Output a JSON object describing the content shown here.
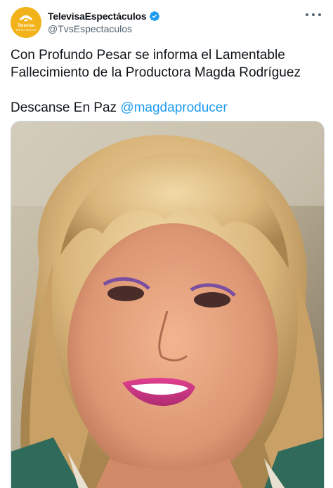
{
  "account": {
    "display_name": "TelevisaEspectáculos",
    "handle": "@TvsEspectaculos",
    "avatar_brand": "Televisa",
    "avatar_sub": "ESPECTÁCULOS",
    "verified": true
  },
  "tweet": {
    "line1": "Con Profundo Pesar se informa el Lamentable",
    "line2": "Fallecimiento de la Productora Magda Rodríguez",
    "line3_prefix": "Descanse En Paz ",
    "mention": "@magdaproducer"
  },
  "media": {
    "description_icon": "photo"
  },
  "colors": {
    "accent": "#1d9bf0",
    "avatar_bg": "#f2b21a",
    "text": "#0f1419",
    "muted": "#536471"
  }
}
